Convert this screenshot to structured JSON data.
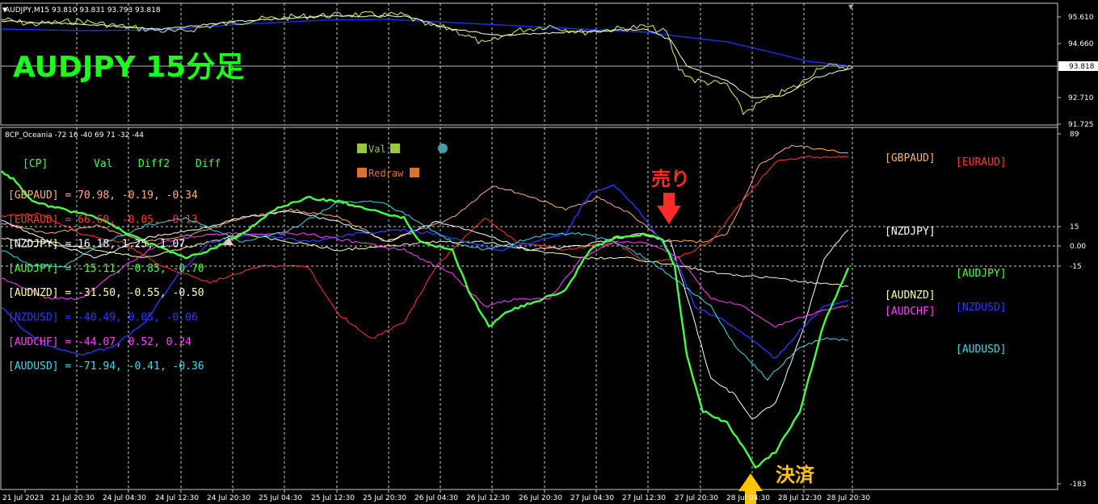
{
  "colors": {
    "background": "#000000",
    "grid": "#c8c8c8",
    "price_line": "#e8ff6a",
    "ma_line": "#1f32ff",
    "zero_line": "#9a9a9a",
    "annotation_red": "#ff2b2b",
    "annotation_yellow": "#ffc400",
    "title_green": "#1aff1a"
  },
  "price_panel": {
    "header": "AUDJPY,M15  93.810 93.831 93.793 93.818",
    "title": "AUDJPY 15分足",
    "price_scale": [
      "95.610",
      "94.660",
      "93.818",
      "92.710",
      "91.725"
    ],
    "current_price": "93.818"
  },
  "indicator_panel": {
    "header": "8CP_Oceania -72 16 -40 69 71 -32 -44",
    "scale": [
      "89",
      "15",
      "0.00",
      "-15",
      "-183"
    ],
    "legend": {
      "val": "Val",
      "redraw": "Redraw"
    },
    "table_headers": [
      "[CP]",
      "Val",
      "Diff2",
      "Diff"
    ],
    "rows": [
      {
        "text": "[GBPAUD] =  70.98,  -0.19,  -0.34",
        "color": "#ffb07a"
      },
      {
        "text": "[EURAUD] =  66.60,  -0.05,  -0.13",
        "color": "#ff3a2a"
      },
      {
        "text": "[NZDJPY] =  16.18,   1.25,   1.07",
        "color": "#ffffff"
      },
      {
        "text": "[AUDJPY] = -15.11,  -0.85,  -0.70",
        "color": "#46ff46"
      },
      {
        "text": "[AUDNZD] = -31.50,  -0.55,  -0.50",
        "color": "#ffffb0"
      },
      {
        "text": "[NZDUSD] = -40.49,   0.05,  -0.06",
        "color": "#2a3cff"
      },
      {
        "text": "[AUDCHF] = -44.07,   0.52,   0.24",
        "color": "#ff44ff"
      },
      {
        "text": "[AUDUSD] = -71.94,  -0.41,  -0.36",
        "color": "#46d8e8"
      }
    ],
    "right_labels": [
      {
        "text": "[GBPAUD]",
        "color": "#ffb07a"
      },
      {
        "text": "[EURAUD]",
        "color": "#ff3a2a"
      },
      {
        "text": "[NZDJPY]",
        "color": "#ffffff"
      },
      {
        "text": "[AUDJPY]",
        "color": "#46ff46"
      },
      {
        "text": "[AUDNZD]",
        "color": "#ffffb0"
      },
      {
        "text": "[NZDUSD]",
        "color": "#2a3cff"
      },
      {
        "text": "[AUDCHF]",
        "color": "#ff44ff"
      },
      {
        "text": "[AUDUSD]",
        "color": "#46d8e8"
      }
    ],
    "annotations": {
      "sell": "売り",
      "settle": "決済"
    }
  },
  "time_axis": [
    "21 Jul 2023",
    "21 Jul 20:30",
    "24 Jul 04:30",
    "24 Jul 12:30",
    "24 Jul 20:30",
    "25 Jul 04:30",
    "25 Jul 12:30",
    "25 Jul 20:30",
    "26 Jul 04:30",
    "26 Jul 12:30",
    "26 Jul 20:30",
    "27 Jul 04:30",
    "27 Jul 12:30",
    "27 Jul 20:30",
    "28 Jul 04:30",
    "28 Jul 12:30",
    "28 Jul 20:30"
  ]
}
